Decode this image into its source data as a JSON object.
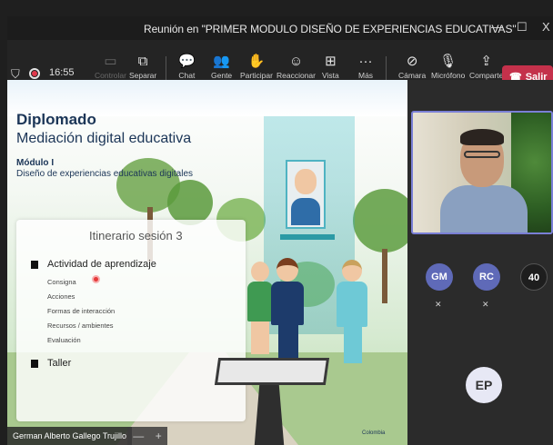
{
  "window": {
    "title": "Reunión en \"PRIMER MODULO DISEÑO DE EXPERIENCIAS EDUCATIVAS\"",
    "minimize_icon": "minimize-icon",
    "maximize_icon": "maximize-icon",
    "close_icon": "close-icon"
  },
  "toolbar": {
    "timer": "16:55",
    "items": [
      {
        "label": "Controlar",
        "icon": "control-icon"
      },
      {
        "label": "Separar",
        "icon": "popout-icon"
      },
      {
        "label": "Chat",
        "icon": "chat-icon"
      },
      {
        "label": "Gente",
        "icon": "people-icon"
      },
      {
        "label": "Participar",
        "icon": "raise-hand-icon"
      },
      {
        "label": "Reaccionar",
        "icon": "react-icon"
      },
      {
        "label": "Vista",
        "icon": "view-icon"
      },
      {
        "label": "Más",
        "icon": "more-icon"
      },
      {
        "label": "Cámara",
        "icon": "camera-off-icon"
      },
      {
        "label": "Micrófono",
        "icon": "mic-off-icon"
      },
      {
        "label": "Comparte",
        "icon": "share-icon"
      }
    ],
    "leave_label": "Salir"
  },
  "slide": {
    "title": "Diplomado",
    "subtitle": "Mediación digital educativa",
    "module": "Módulo I",
    "module_name": "Diseño de experiencias educativas digitales",
    "panel_title": "Itinerario sesión 3",
    "activity": "Actividad de aprendizaje",
    "subitems": [
      "Consigna",
      "Acciones",
      "Formas de interacción",
      "Recursos / ambientes",
      "Evaluación"
    ],
    "taller": "Taller",
    "country": "Colombia"
  },
  "presenter": {
    "name": "German Alberto Gallego Trujillo",
    "zoom_minus": "—",
    "zoom_plus": "+"
  },
  "participants": [
    {
      "initials": "GM",
      "color": "#5f6ab8"
    },
    {
      "initials": "RC",
      "color": "#5f6ab8"
    },
    {
      "initials": "40",
      "color": "#1e1e1e"
    }
  ],
  "ep": "EP"
}
